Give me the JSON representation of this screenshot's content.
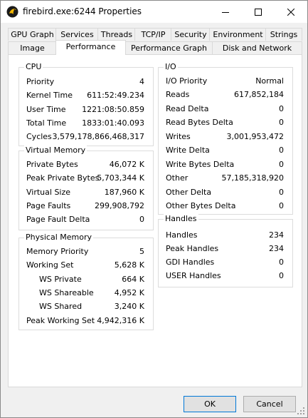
{
  "window": {
    "title": "firebird.exe:6244 Properties"
  },
  "tabs_top": [
    "GPU Graph",
    "Services",
    "Threads",
    "TCP/IP",
    "Security",
    "Environment",
    "Strings"
  ],
  "tabs_bottom": [
    "Image",
    "Performance",
    "Performance Graph",
    "Disk and Network"
  ],
  "active_tab": "Performance",
  "cpu": {
    "title": "CPU",
    "rows": [
      {
        "label": "Priority",
        "value": "4"
      },
      {
        "label": "Kernel Time",
        "value": "611:52:49.234"
      },
      {
        "label": "User Time",
        "value": "1221:08:50.859"
      },
      {
        "label": "Total Time",
        "value": "1833:01:40.093"
      },
      {
        "label": "Cycles",
        "value": "3,579,178,866,468,317"
      }
    ]
  },
  "virtual_memory": {
    "title": "Virtual Memory",
    "rows": [
      {
        "label": "Private Bytes",
        "value": "46,072 K"
      },
      {
        "label": "Peak Private Bytes",
        "value": "5,703,344 K"
      },
      {
        "label": "Virtual Size",
        "value": "187,960 K"
      },
      {
        "label": "Page Faults",
        "value": "299,908,792"
      },
      {
        "label": "Page Fault Delta",
        "value": "0"
      }
    ]
  },
  "physical_memory": {
    "title": "Physical Memory",
    "rows": [
      {
        "label": "Memory Priority",
        "value": "5"
      },
      {
        "label": "Working Set",
        "value": "5,628 K"
      },
      {
        "label": "WS Private",
        "value": "664 K"
      },
      {
        "label": "WS Shareable",
        "value": "4,952 K"
      },
      {
        "label": "WS Shared",
        "value": "3,240 K"
      },
      {
        "label": "Peak Working Set",
        "value": "4,942,316 K"
      }
    ]
  },
  "io": {
    "title": "I/O",
    "rows": [
      {
        "label": "I/O Priority",
        "value": "Normal"
      },
      {
        "label": "Reads",
        "value": "617,852,184"
      },
      {
        "label": "Read Delta",
        "value": "0"
      },
      {
        "label": "Read Bytes Delta",
        "value": "0"
      },
      {
        "label": "Writes",
        "value": "3,001,953,472"
      },
      {
        "label": "Write Delta",
        "value": "0"
      },
      {
        "label": "Write Bytes Delta",
        "value": "0"
      },
      {
        "label": "Other",
        "value": "57,185,318,920"
      },
      {
        "label": "Other Delta",
        "value": "0"
      },
      {
        "label": "Other Bytes Delta",
        "value": "0"
      }
    ]
  },
  "handles": {
    "title": "Handles",
    "rows": [
      {
        "label": "Handles",
        "value": "234"
      },
      {
        "label": "Peak Handles",
        "value": "234"
      },
      {
        "label": "GDI Handles",
        "value": "0"
      },
      {
        "label": "USER Handles",
        "value": "0"
      }
    ]
  },
  "buttons": {
    "ok": "OK",
    "cancel": "Cancel"
  }
}
